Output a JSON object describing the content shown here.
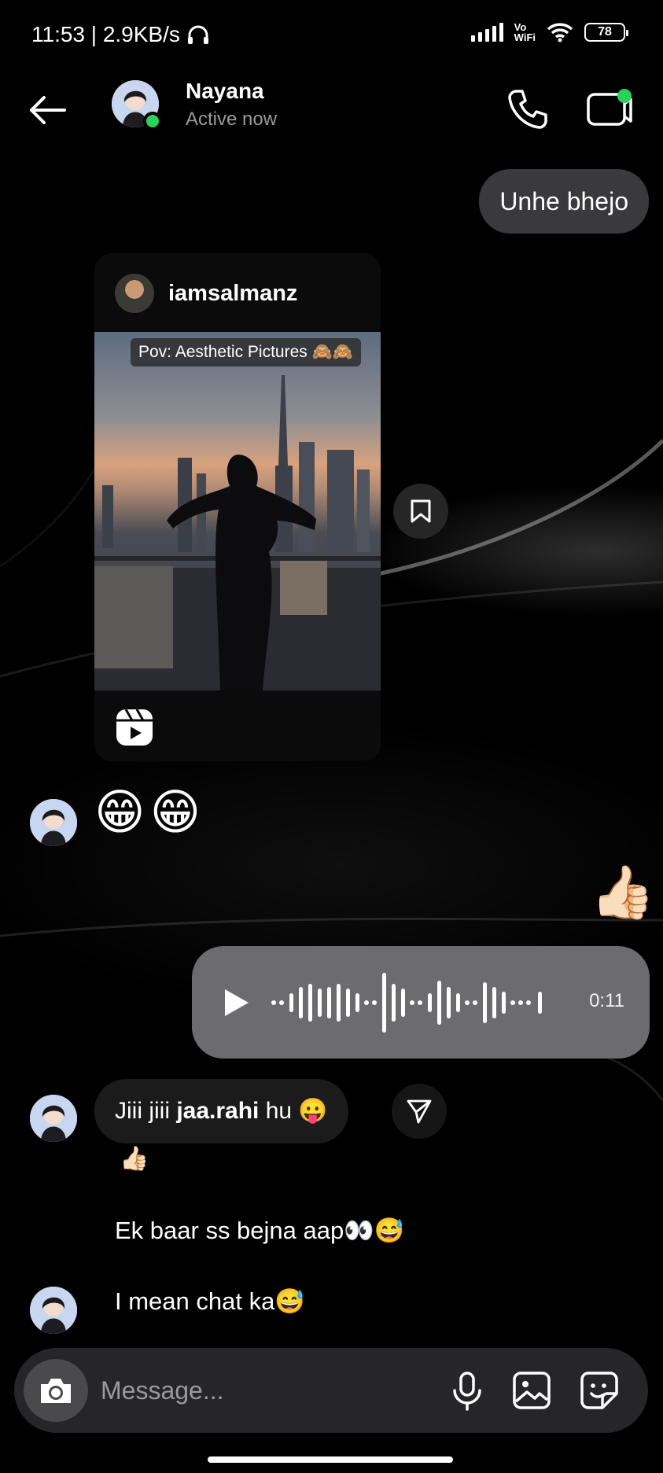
{
  "status_bar": {
    "time_speed": "11:53 | 2.9KB/s",
    "network": "Vo\nWiFi",
    "battery": "78"
  },
  "header": {
    "name": "Nayana",
    "status": "Active now"
  },
  "messages": {
    "outgoing_1": "Unhe bhejo",
    "shared_post": {
      "username": "iamsalmanz",
      "caption": "Pov: Aesthetic Pictures 🙈🙈"
    },
    "incoming_emoji": "😁😁",
    "outgoing_thumb": "👍🏻",
    "voice_note": {
      "duration": "0:11"
    },
    "incoming_mention": {
      "prefix": "Jiii jiii ",
      "mention": "jaa.rahi",
      "suffix": " hu 😛",
      "reaction": "👍🏻"
    },
    "incoming_2": "Ek baar ss bejna aap👀😅",
    "incoming_3": "I mean chat ka😅"
  },
  "composer": {
    "placeholder": "Message..."
  },
  "colors": {
    "background": "#000000",
    "outgoing_bubble": "#3a3a3c",
    "voice_bubble": "#6c6c6e",
    "incoming_bubble": "#1b1b1b",
    "online_dot": "#2bd159"
  }
}
